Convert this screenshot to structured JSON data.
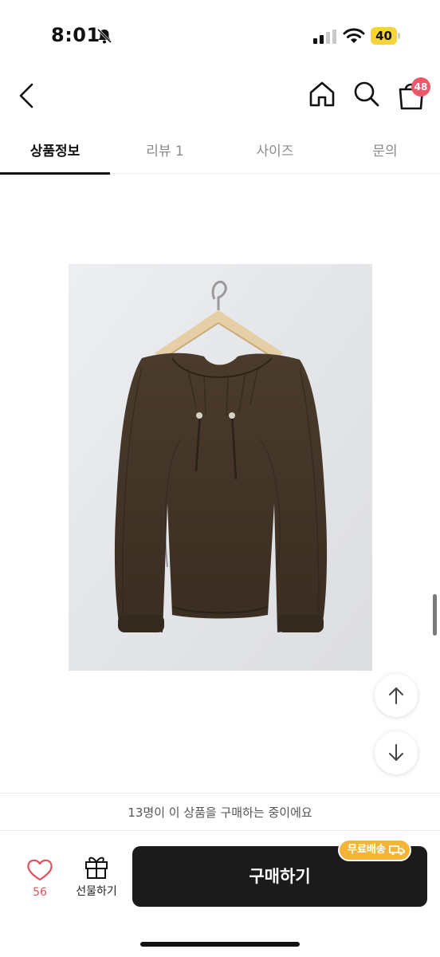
{
  "status_bar": {
    "time": "8:01",
    "battery": "40"
  },
  "header": {
    "cart_count": "48"
  },
  "tabs": [
    {
      "label": "상품정보",
      "active": true
    },
    {
      "label": "리뷰 1",
      "active": false
    },
    {
      "label": "사이즈",
      "active": false
    },
    {
      "label": "문의",
      "active": false
    }
  ],
  "product": {
    "image_subject": "brown long-sleeve blouse on a hanger"
  },
  "purchase_bar": {
    "buyers_notice": "13명이 이 상품을 구매하는 중이에요",
    "like_count": "56",
    "gift_label": "선물하기",
    "buy_label": "구매하기",
    "free_shipping_badge": "무료배송"
  },
  "colors": {
    "accent_badge": "#f0566a",
    "like": "#e0525e",
    "buy_button": "#1b1b1b",
    "shipping_badge": "#f4b43a"
  }
}
